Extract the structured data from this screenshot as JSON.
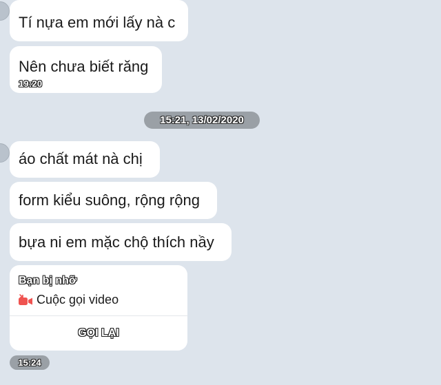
{
  "colors": {
    "background": "#dde4ec",
    "bubble": "#ffffff",
    "pill": "#9aa0a6",
    "call_icon": "#ef5350"
  },
  "group1": {
    "messages": [
      {
        "text": "Tí nựa em mới lấy nà c"
      },
      {
        "text": "Nên chưa biết răng",
        "time": "19:20"
      }
    ]
  },
  "date_separator": "15:21, 13/02/2020",
  "group2": {
    "messages": [
      {
        "text": "áo chất mát nà chị"
      },
      {
        "text": "form kiểu suông, rộng rộng"
      },
      {
        "text": "bựa ni em mặc chộ thích nầy"
      }
    ]
  },
  "call_card": {
    "title": "Bạn bị nhỡ",
    "icon": "missed-video-call-icon",
    "label": "Cuộc gọi video",
    "action": "GỌI LẠI"
  },
  "last_time": "15:24"
}
